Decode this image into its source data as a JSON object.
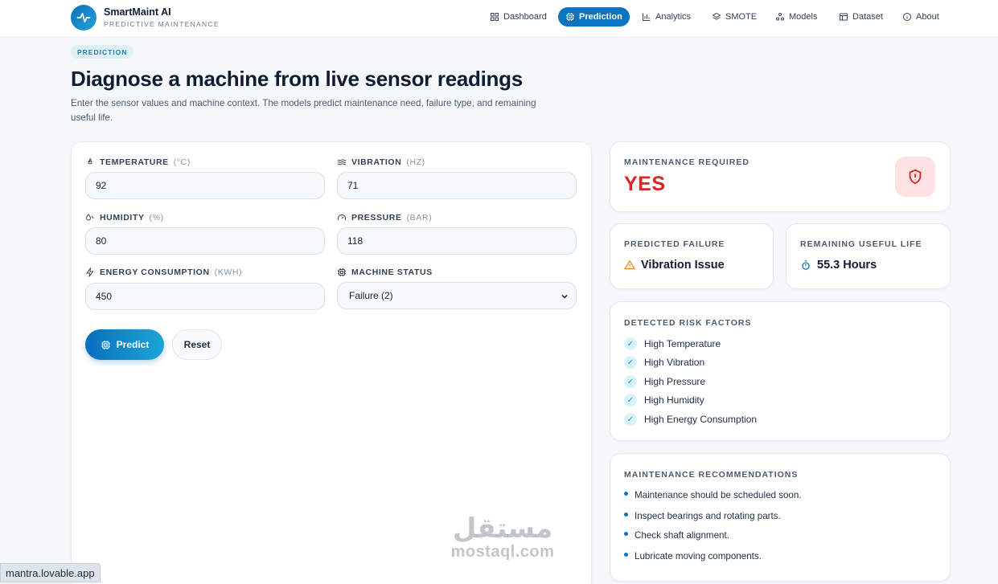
{
  "brand": {
    "name": "SmartMaint AI",
    "subtitle": "PREDICTIVE MAINTENANCE"
  },
  "nav": [
    {
      "label": "Dashboard",
      "icon": "grid-icon"
    },
    {
      "label": "Prediction",
      "icon": "cpu-icon",
      "active": true
    },
    {
      "label": "Analytics",
      "icon": "bar-chart-icon"
    },
    {
      "label": "SMOTE",
      "icon": "layers-icon"
    },
    {
      "label": "Models",
      "icon": "network-icon"
    },
    {
      "label": "Dataset",
      "icon": "table-icon"
    },
    {
      "label": "About",
      "icon": "info-icon"
    }
  ],
  "intro": {
    "pill": "PREDICTION",
    "title": "Diagnose a machine from live sensor readings",
    "description": "Enter the sensor values and machine context. The models predict maintenance need, failure type, and remaining useful life."
  },
  "form": {
    "temperature": {
      "label": "TEMPERATURE",
      "unit": "(°C)",
      "value": "92"
    },
    "vibration": {
      "label": "VIBRATION",
      "unit": "(HZ)",
      "value": "71"
    },
    "humidity": {
      "label": "HUMIDITY",
      "unit": "(%)",
      "value": "80"
    },
    "pressure": {
      "label": "PRESSURE",
      "unit": "(BAR)",
      "value": "118"
    },
    "energy": {
      "label": "ENERGY CONSUMPTION",
      "unit": "(KWH)",
      "value": "450"
    },
    "machine_status": {
      "label": "MACHINE STATUS",
      "selected": "Failure (2)"
    },
    "predict_label": "Predict",
    "reset_label": "Reset"
  },
  "results": {
    "maintenance": {
      "label": "MAINTENANCE REQUIRED",
      "value": "YES"
    },
    "failure": {
      "label": "PREDICTED FAILURE",
      "value": "Vibration Issue"
    },
    "rul": {
      "label": "REMAINING USEFUL LIFE",
      "value": "55.3 Hours"
    },
    "risk": {
      "label": "DETECTED RISK FACTORS",
      "items": [
        "High Temperature",
        "High Vibration",
        "High Pressure",
        "High Humidity",
        "High Energy Consumption"
      ]
    },
    "recommendations": {
      "label": "MAINTENANCE RECOMMENDATIONS",
      "items": [
        "Maintenance should be scheduled soon.",
        "Inspect bearings and rotating parts.",
        "Check shaft alignment.",
        "Lubricate moving components."
      ]
    }
  },
  "watermark": {
    "arabic": "مستقل",
    "latin": "mostaql.com"
  },
  "status_url": "mantra.lovable.app",
  "colors": {
    "accent": "#0a74c0",
    "danger": "#dc2626",
    "warning": "#f08a24"
  }
}
